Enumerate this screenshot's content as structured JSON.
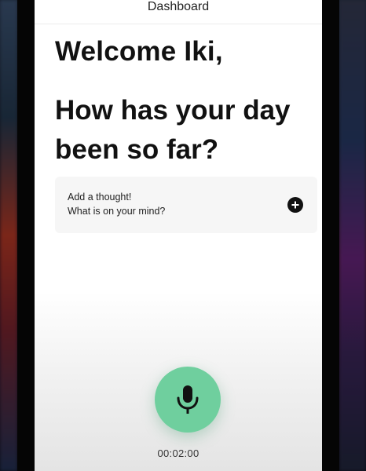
{
  "header": {
    "title": "Dashboard"
  },
  "greeting": {
    "welcome": "Welcome Iki,",
    "question": "How has your day been so far?"
  },
  "thought_card": {
    "line1": "Add a thought!",
    "line2": "What is on your mind?",
    "add_icon": "plus-circle-icon"
  },
  "recorder": {
    "mic_icon": "microphone-icon",
    "accent_color": "#6fcf9e",
    "timer": "00:02:00"
  }
}
